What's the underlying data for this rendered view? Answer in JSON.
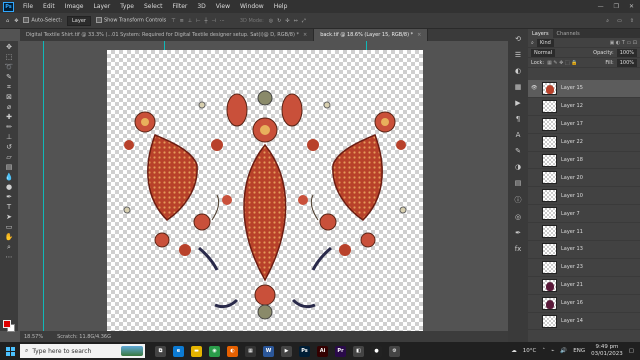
{
  "menubar": {
    "logo": "Ps",
    "items": [
      "File",
      "Edit",
      "Image",
      "Layer",
      "Type",
      "Select",
      "Filter",
      "3D",
      "View",
      "Window",
      "Help"
    ],
    "window_controls": [
      "—",
      "❐",
      "✕"
    ]
  },
  "options": {
    "auto_select_label": "Auto-Select:",
    "auto_select_value": "Layer",
    "transform_label": "Show Transform Controls",
    "mode_3d": "3D Mode:"
  },
  "tabs": [
    {
      "label": "Digital Textile Shirt.tif @ 33.3% (...01 System: Required for Digital Textile designer setup. Sat(i)@ D, RGB/8) *",
      "active": false
    },
    {
      "label": "back.tif @ 18.6% (Layer 15, RGB/8) *",
      "active": true
    }
  ],
  "status": {
    "zoom": "18.57%",
    "scratch": "Scratch: 11.8G/4.36G"
  },
  "layers_panel": {
    "tabs": [
      "Layers",
      "Channels"
    ],
    "kind": "Kind",
    "blend_mode": "Normal",
    "opacity_label": "Opacity:",
    "opacity": "100%",
    "lock_label": "Lock:",
    "fill_label": "Fill:",
    "fill": "100%",
    "layers": [
      {
        "name": "Layer 15",
        "selected": true,
        "visible": true,
        "thumb": "art"
      },
      {
        "name": "Layer 12",
        "selected": false,
        "visible": false,
        "thumb": "blank"
      },
      {
        "name": "Layer 17",
        "selected": false,
        "visible": false,
        "thumb": "blank"
      },
      {
        "name": "Layer 22",
        "selected": false,
        "visible": false,
        "thumb": "blank"
      },
      {
        "name": "Layer 18",
        "selected": false,
        "visible": false,
        "thumb": "blank"
      },
      {
        "name": "Layer 20",
        "selected": false,
        "visible": false,
        "thumb": "blank"
      },
      {
        "name": "Layer 10",
        "selected": false,
        "visible": false,
        "thumb": "blank"
      },
      {
        "name": "Layer 7",
        "selected": false,
        "visible": false,
        "thumb": "blank"
      },
      {
        "name": "Layer 11",
        "selected": false,
        "visible": false,
        "thumb": "blank"
      },
      {
        "name": "Layer 13",
        "selected": false,
        "visible": false,
        "thumb": "blank"
      },
      {
        "name": "Layer 23",
        "selected": false,
        "visible": false,
        "thumb": "blank"
      },
      {
        "name": "Layer 21",
        "selected": false,
        "visible": false,
        "thumb": "dark"
      },
      {
        "name": "Layer 16",
        "selected": false,
        "visible": false,
        "thumb": "dark"
      },
      {
        "name": "Layer 14",
        "selected": false,
        "visible": false,
        "thumb": "blank"
      }
    ]
  },
  "colors": {
    "foreground": "#e00000",
    "background": "#ffffff",
    "accent": "#31a8ff",
    "guide": "#00d2d2"
  },
  "taskbar": {
    "search_placeholder": "Type here to search",
    "apps": [
      {
        "icon": "task-view-icon",
        "label": "⧉",
        "color": "#444"
      },
      {
        "icon": "edge-icon",
        "label": "e",
        "color": "#0c7bd4"
      },
      {
        "icon": "explorer-icon",
        "label": "▬",
        "color": "#e5b400"
      },
      {
        "icon": "chrome-icon",
        "label": "◉",
        "color": "#2a9d4a"
      },
      {
        "icon": "firefox-icon",
        "label": "◐",
        "color": "#e66000"
      },
      {
        "icon": "store-icon",
        "label": "▦",
        "color": "#333"
      },
      {
        "icon": "word-icon",
        "label": "W",
        "color": "#2b579a"
      },
      {
        "icon": "media-icon",
        "label": "▶",
        "color": "#444"
      },
      {
        "icon": "photoshop-icon",
        "label": "Ps",
        "color": "#001e36"
      },
      {
        "icon": "illustrator-icon",
        "label": "Ai",
        "color": "#330000"
      },
      {
        "icon": "premiere-icon",
        "label": "Pr",
        "color": "#2a0a4a"
      },
      {
        "icon": "app-icon",
        "label": "◧",
        "color": "#444"
      },
      {
        "icon": "circle-icon",
        "label": "●",
        "color": "#222"
      },
      {
        "icon": "settings-icon",
        "label": "⚙",
        "color": "#444"
      }
    ],
    "weather": "10°C",
    "lang": "ENG",
    "time": "9:49 pm",
    "date": "03/01/2023"
  }
}
